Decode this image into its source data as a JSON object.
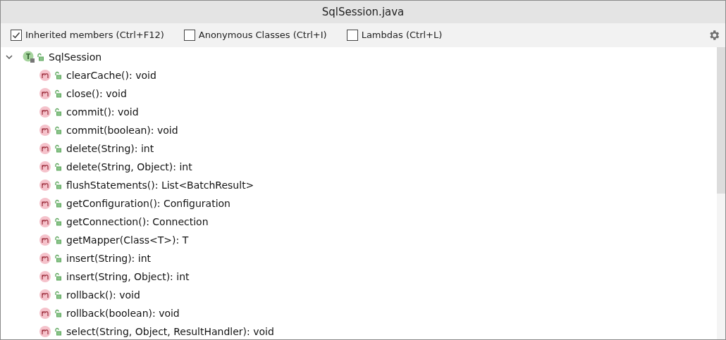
{
  "window": {
    "title": "SqlSession.java"
  },
  "toolbar": {
    "options": [
      {
        "label": "Inherited members (Ctrl+F12)",
        "checked": true
      },
      {
        "label": "Anonymous Classes (Ctrl+I)",
        "checked": false
      },
      {
        "label": "Lambdas (Ctrl+L)",
        "checked": false
      }
    ]
  },
  "tree": {
    "root": {
      "label": "SqlSession",
      "expanded": true,
      "children": [
        {
          "label": "clearCache(): void"
        },
        {
          "label": "close(): void"
        },
        {
          "label": "commit(): void"
        },
        {
          "label": "commit(boolean): void"
        },
        {
          "label": "delete(String): int"
        },
        {
          "label": "delete(String, Object): int"
        },
        {
          "label": "flushStatements(): List<BatchResult>"
        },
        {
          "label": "getConfiguration(): Configuration"
        },
        {
          "label": "getConnection(): Connection"
        },
        {
          "label": "getMapper(Class<T>): T"
        },
        {
          "label": "insert(String): int"
        },
        {
          "label": "insert(String, Object): int"
        },
        {
          "label": "rollback(): void"
        },
        {
          "label": "rollback(boolean): void"
        },
        {
          "label": "select(String, Object, ResultHandler): void"
        }
      ]
    }
  }
}
